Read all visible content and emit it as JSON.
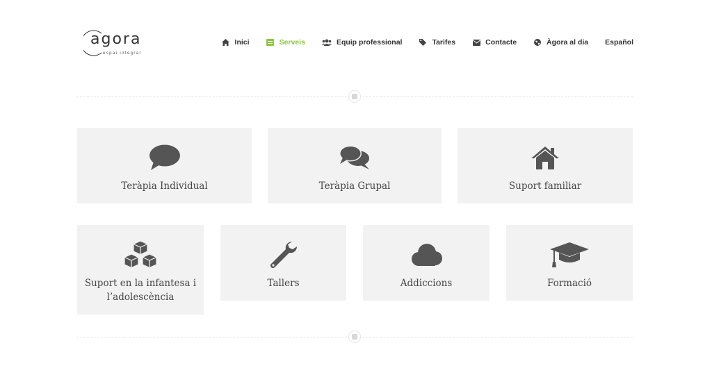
{
  "logo": {
    "word": "agora",
    "tagline": "espai integral"
  },
  "nav": {
    "items": [
      {
        "label": "Inici",
        "icon": "home-icon",
        "active": false
      },
      {
        "label": "Serveis",
        "icon": "list-icon",
        "active": true
      },
      {
        "label": "Equip professional",
        "icon": "users-icon",
        "active": false
      },
      {
        "label": "Tarifes",
        "icon": "tag-icon",
        "active": false
      },
      {
        "label": "Contacte",
        "icon": "envelope-icon",
        "active": false
      },
      {
        "label": "Àgora al dia",
        "icon": "globe-icon",
        "active": false
      },
      {
        "label": "Español",
        "icon": "",
        "active": false
      }
    ]
  },
  "services": [
    {
      "label": "Teràpia Individual",
      "icon": "comment-icon"
    },
    {
      "label": "Teràpia Grupal",
      "icon": "comments-icon"
    },
    {
      "label": "Suport familiar",
      "icon": "home-icon"
    },
    {
      "label": "Suport en la infantesa i l’adolescència",
      "icon": "cubes-icon"
    },
    {
      "label": "Tallers",
      "icon": "wrench-icon"
    },
    {
      "label": "Addiccions",
      "icon": "cloud-icon"
    },
    {
      "label": "Formació",
      "icon": "graduation-cap-icon"
    }
  ],
  "colors": {
    "accent": "#8cc63f",
    "card_bg": "#f2f2f2",
    "icon": "#555555",
    "text": "#444444"
  }
}
